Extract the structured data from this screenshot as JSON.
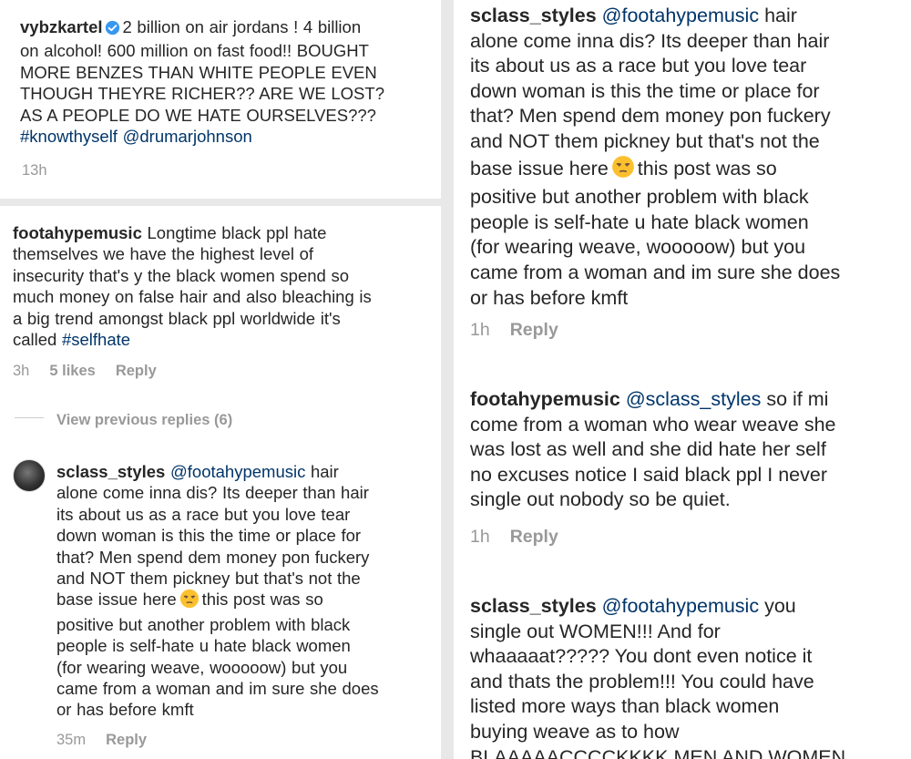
{
  "post": {
    "username": "vybzkartel",
    "caption_lines": [
      "2 billion on air jordans ! 4 billion",
      "on alcohol! 600 million on fast food!! BOUGHT",
      "MORE BENZES THAN WHITE PEOPLE EVEN",
      "THOUGH THEYRE RICHER?? ARE WE LOST?",
      "AS A PEOPLE DO WE HATE OURSELVES???"
    ],
    "hashtag": "#knowthyself",
    "mention": "@drumarjohnson",
    "time": "13h"
  },
  "comment1": {
    "username": "footahypemusic",
    "lines": [
      "Longtime black ppl hate",
      "themselves we have the highest level of",
      "insecurity that's y the black women spend so",
      "much money on false hair and also bleaching is",
      "a big trend amongst black ppl worldwide it's",
      "called"
    ],
    "hashtag": "#selfhate",
    "time": "3h",
    "likes": "5 likes",
    "reply": "Reply"
  },
  "view_previous": "View previous replies (6)",
  "reply_left": {
    "username": "sclass_styles",
    "mention": "@footahypemusic",
    "first_line_rest": "hair",
    "lines": [
      "alone come inna dis? Its deeper than hair",
      "its about us as a race but you love tear",
      "down woman is this the time or place for",
      "that? Men spend dem money pon fuckery",
      "and NOT them pickney but that's not the"
    ],
    "base_line_before": "base issue here",
    "base_line_after": "this post was so",
    "lines_after": [
      "positive but another problem with black",
      "people is self-hate u hate black women",
      "(for wearing weave, wooooow) but you",
      "came from a woman and im sure she does",
      "or has before kmft"
    ],
    "time": "35m",
    "reply": "Reply"
  },
  "right": {
    "reply1": {
      "username": "sclass_styles",
      "mention": "@footahypemusic",
      "first_line_rest": "hair",
      "lines": [
        "alone come inna dis? Its deeper than hair",
        "its about us as a race but you love tear",
        "down woman is this the time or place for",
        "that? Men spend dem money pon fuckery",
        "and NOT them pickney but that's not the"
      ],
      "base_line_before": "base issue here",
      "base_line_after": "this post was so",
      "lines_after": [
        "positive but another problem with black",
        "people is self-hate u hate black women",
        "(for wearing weave, wooooow) but you",
        "came from a woman and im sure she does",
        "or has before kmft"
      ],
      "time": "1h",
      "reply": "Reply"
    },
    "reply2": {
      "username": "footahypemusic",
      "mention": "@sclass_styles",
      "first_line_rest": "so if mi",
      "lines": [
        "come from a woman who wear weave she",
        "was lost as well and she did hate her self",
        "no excuses notice I said black ppl I never",
        "single out nobody so be quiet."
      ],
      "time": "1h",
      "reply": "Reply"
    },
    "reply3": {
      "username": "sclass_styles",
      "mention": "@footahypemusic",
      "first_line_rest": "you",
      "lines": [
        "single out WOMEN!!! And for",
        "whaaaaat????? You dont even notice it",
        "and thats the problem!!! You could have",
        "listed more ways than  black women",
        "buying weave as to how",
        "BLAAAAACCCCKKKK MEN AND WOMEN"
      ]
    }
  },
  "colors": {
    "link": "#003569",
    "meta": "#999999",
    "verified": "#3897f0",
    "text": "#262626"
  },
  "icons": {
    "verified": "verified-badge-icon",
    "emoji": "unamused-face-emoji",
    "avatar": "avatar"
  }
}
